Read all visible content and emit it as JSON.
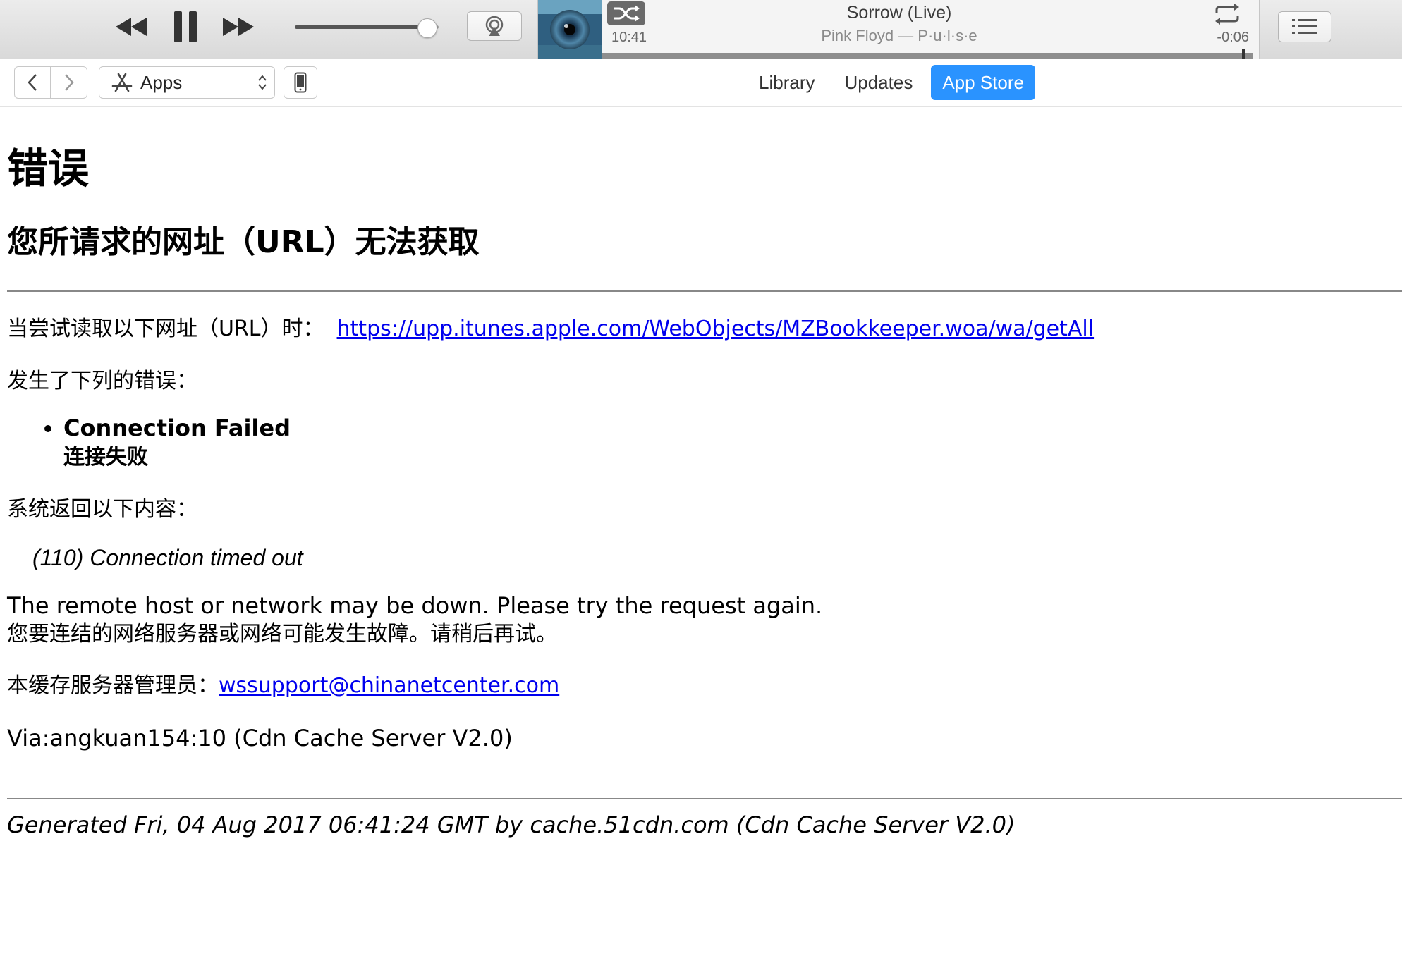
{
  "player": {
    "track_title": "Sorrow (Live)",
    "track_artist": "Pink Floyd — P·u·l·s·e",
    "elapsed": "10:41",
    "remaining": "-0:06",
    "volume": 0.92,
    "progress": 0.985,
    "icons": {
      "prev": "rewind-icon",
      "pause": "pause-icon",
      "next": "fast-forward-icon",
      "airplay": "airplay-icon",
      "shuffle": "shuffle-icon",
      "repeat": "repeat-icon",
      "up_next": "list-icon"
    }
  },
  "navbar": {
    "media_kind": "Apps",
    "tabs": [
      {
        "label": "Library",
        "active": false
      },
      {
        "label": "Updates",
        "active": false
      },
      {
        "label": "App Store",
        "active": true
      }
    ],
    "accent_color": "#2a93ff"
  },
  "page": {
    "heading": "错误",
    "subheading": "您所请求的网址（URL）无法获取",
    "url_prefix": "当尝试读取以下网址（URL）时：",
    "url": "https://upp.itunes.apple.com/WebObjects/MZBookkeeper.woa/wa/getAll",
    "errors_intro": "发生了下列的错误：",
    "error_en": "Connection Failed",
    "error_cn": "连接失败",
    "system_intro": "系统返回以下内容：",
    "system_message": "(110) Connection timed out",
    "remote_en": "The remote host or network may be down. Please try the request again.",
    "remote_cn": "您要连结的网络服务器或网络可能发生故障。请稍后再试。",
    "admin_label": "本缓存服务器管理员：",
    "admin_email": "wssupport@chinanetcenter.com",
    "via": "Via:angkuan154:10 (Cdn Cache Server V2.0)",
    "generated": "Generated Fri, 04 Aug 2017 06:41:24 GMT by cache.51cdn.com (Cdn Cache Server V2.0)",
    "link_color": "#0000ee"
  }
}
